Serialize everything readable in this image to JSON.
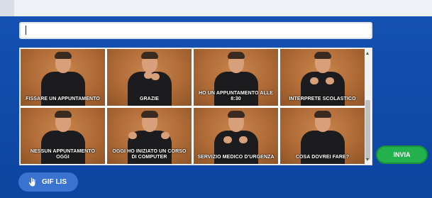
{
  "composer": {
    "input_value": "",
    "placeholder": ""
  },
  "suggestions": [
    {
      "caption": "FISSARE UN APPUNTAMENTO",
      "pose": "neutral"
    },
    {
      "caption": "GRAZIE",
      "pose": "chin"
    },
    {
      "caption": "HO UN APPUNTAMENTO ALLE 8:30",
      "pose": "neutral"
    },
    {
      "caption": "INTERPRETE SCOLASTICO",
      "pose": "chest"
    },
    {
      "caption": "NESSUN APPUNTAMENTO OGGI",
      "pose": "neutral"
    },
    {
      "caption": "OGGI HO INIZIATO UN CORSO DI COMPUTER",
      "pose": "raised"
    },
    {
      "caption": "SERVIZIO MEDICO D'URGENZA",
      "pose": "chest"
    },
    {
      "caption": "COSA DOVREI FARE?",
      "pose": "neutral"
    }
  ],
  "actions": {
    "send_label": "INVIA",
    "gif_label": "GIF LIS"
  },
  "colors": {
    "background": "#0f47a3",
    "send_button": "#22b14c",
    "gif_button": "#3b73d1"
  },
  "icons": {
    "gif_button_icon": "hand-icon"
  }
}
